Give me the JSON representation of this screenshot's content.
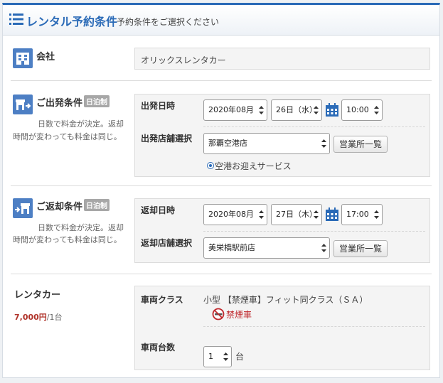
{
  "header": {
    "title": "レンタル予約条件",
    "subtitle": "予約条件をご選択ください"
  },
  "company": {
    "label": "会社",
    "value": "オリックスレンタカー"
  },
  "departure": {
    "title": "ご出発条件",
    "badge": "日泊制",
    "note_line1": "日数で料金が決定。返却",
    "note_line2": "時間が変わっても料金は同じ。",
    "date_label": "出発日時",
    "month": "2020年08月",
    "day": "26日（水）",
    "time": "10:00",
    "store_label": "出発店舗選択",
    "store": "那覇空港店",
    "store_list_button": "営業所一覧",
    "pickup_service": "空港お迎えサービス"
  },
  "return": {
    "title": "ご返却条件",
    "badge": "日泊制",
    "note_line1": "日数で料金が決定。返却",
    "note_line2": "時間が変わっても料金は同じ。",
    "date_label": "返却日時",
    "month": "2020年08月",
    "day": "27日（木）",
    "time": "17:00",
    "store_label": "返却店舗選択",
    "store": "美栄橋駅前店",
    "store_list_button": "営業所一覧"
  },
  "rentacar": {
    "title": "レンタカー",
    "price": "7,000円",
    "price_unit": "/1台",
    "class_label": "車両クラス",
    "class_value": "小型 【禁煙車】フィット同クラス（ＳＡ）",
    "nonsmoking": "禁煙車",
    "count_label": "車両台数",
    "count": "1",
    "count_unit": "台"
  },
  "colors": {
    "accent": "#2a6ab7",
    "price": "#b0332a",
    "nonsmoking": "#c0282d"
  },
  "icons": {
    "header": "list-icon",
    "company": "building-icon",
    "departure": "departure-store-icon",
    "return": "return-store-icon",
    "calendar": "calendar-icon",
    "nonsmoking": "no-smoking-icon"
  }
}
